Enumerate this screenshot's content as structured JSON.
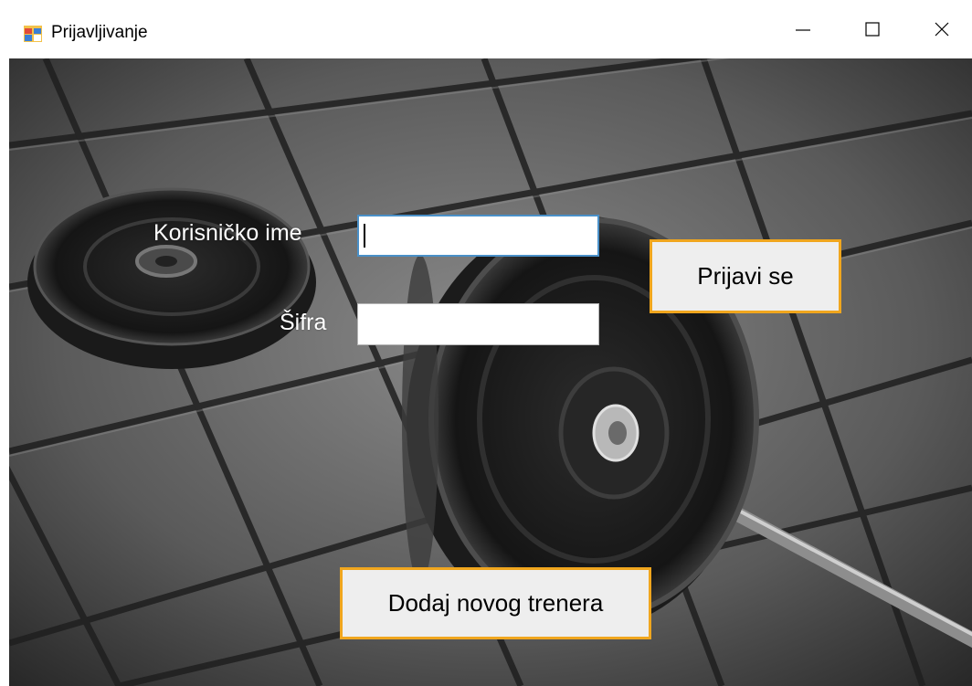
{
  "window": {
    "title": "Prijavljivanje",
    "controls": {
      "minimize": "—",
      "maximize": "☐",
      "close": "✕"
    }
  },
  "form": {
    "username_label": "Korisničko ime",
    "username_value": "",
    "password_label": "Šifra",
    "password_value": ""
  },
  "buttons": {
    "login_label": "Prijavi se",
    "add_trainer_label": "Dodaj novog trenera"
  },
  "colors": {
    "button_border": "#f0a61e",
    "input_focus_border": "#4a90c8"
  }
}
